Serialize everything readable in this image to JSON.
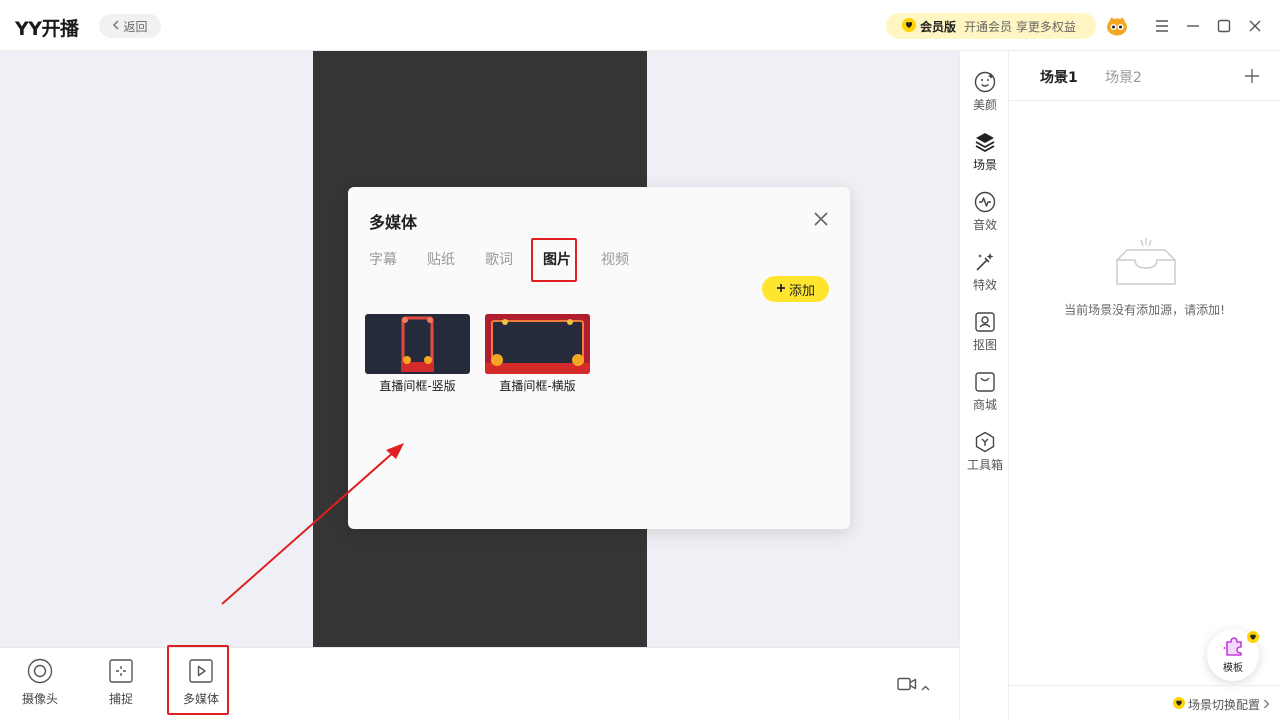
{
  "app": {
    "title": "YY开播",
    "back_label": "返回"
  },
  "vip": {
    "label": "会员版",
    "desc": "开通会员 享更多权益"
  },
  "bottom_tools": [
    {
      "label": "摄像头",
      "icon": "camera-icon"
    },
    {
      "label": "捕捉",
      "icon": "capture-icon"
    },
    {
      "label": "多媒体",
      "icon": "multimedia-icon"
    }
  ],
  "rail": [
    {
      "label": "美颜",
      "icon": "face-icon"
    },
    {
      "label": "场景",
      "icon": "layers-icon"
    },
    {
      "label": "音效",
      "icon": "sound-wave-icon"
    },
    {
      "label": "特效",
      "icon": "magic-wand-icon"
    },
    {
      "label": "抠图",
      "icon": "portrait-cutout-icon"
    },
    {
      "label": "商城",
      "icon": "shopping-bag-icon"
    },
    {
      "label": "工具箱",
      "icon": "toolbox-icon"
    }
  ],
  "scene": {
    "tabs": [
      "场景1",
      "场景2"
    ],
    "empty_text": "当前场景没有添加源，请添加!",
    "template_label": "模板",
    "switch_config": "场景切换配置"
  },
  "dialog": {
    "title": "多媒体",
    "tabs": [
      "字幕",
      "贴纸",
      "歌词",
      "图片",
      "视频"
    ],
    "active_tab": "图片",
    "add_label": "添加",
    "images": [
      {
        "name": "直播间框-竖版"
      },
      {
        "name": "直播间框-横版"
      }
    ]
  },
  "colors": {
    "accent_yellow": "#ffe52e",
    "highlight_red": "#e02020",
    "canvas_dark": "#353535"
  }
}
